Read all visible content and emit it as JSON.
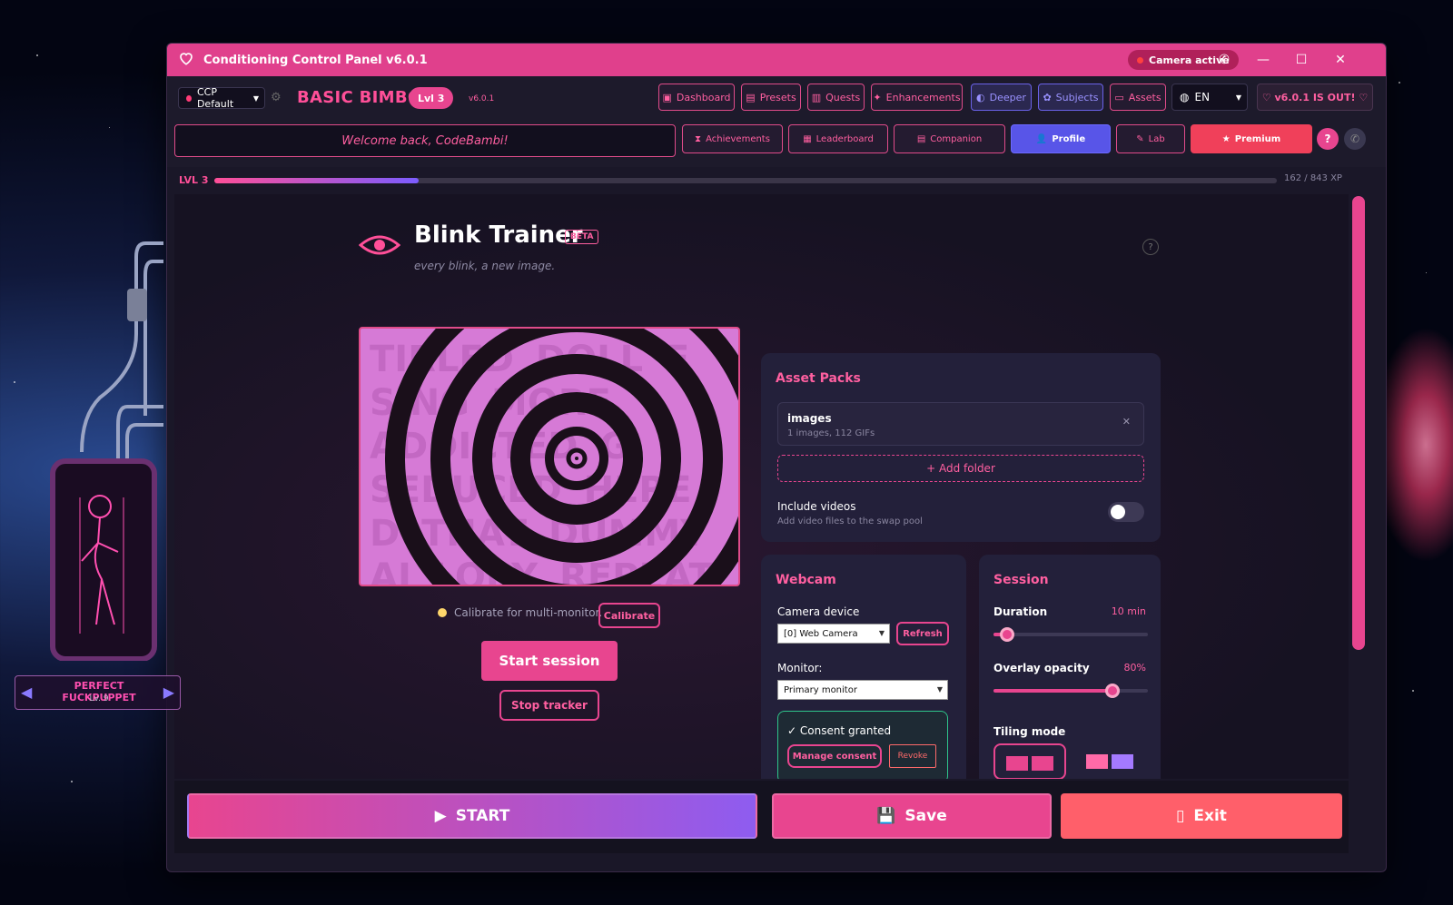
{
  "window": {
    "title": "Conditioning Control Panel v6.0.1",
    "camera_status": "Camera active"
  },
  "header": {
    "preset": "CCP Default",
    "brand": "BASIC BIMBO",
    "level_badge": "Lvl 3",
    "version": "v6.0.1",
    "nav": [
      {
        "label": "Dashboard",
        "icon": "dashboard-icon"
      },
      {
        "label": "Presets",
        "icon": "presets-icon"
      },
      {
        "label": "Quests",
        "icon": "quests-icon"
      },
      {
        "label": "Enhancements",
        "icon": "enhancements-icon"
      },
      {
        "label": "Deeper",
        "icon": "deeper-icon"
      },
      {
        "label": "Subjects",
        "icon": "subjects-icon"
      },
      {
        "label": "Assets",
        "icon": "folder-icon"
      }
    ],
    "language": "EN",
    "update_notice": "v6.0.1 IS OUT!"
  },
  "subnav": {
    "welcome": "Welcome back, CodeBambi!",
    "items": [
      {
        "label": "Achievements"
      },
      {
        "label": "Leaderboard"
      },
      {
        "label": "Companion"
      },
      {
        "label": "Profile"
      },
      {
        "label": "Lab"
      },
      {
        "label": "Premium"
      }
    ],
    "help": "?"
  },
  "xp": {
    "level_label": "LVL 3",
    "current": 162,
    "max": 843,
    "text": "162 / 843 XP",
    "fraction": 0.192
  },
  "blink_trainer": {
    "title": "Blink Trainer",
    "badge": "BETA",
    "tagline": "every blink, a new image.",
    "help": "?",
    "preview_bg_text": "TIRLED   DOLL E SING  MORE ADDICTED  G SEDUCED HERE D  THAT  DUMMY  AI  LOBY  REPEAT  MA ACTUALLY STOCKH  LOVE  MORE ADDIC",
    "calibrate_hint": "Calibrate for multi-monitor.",
    "calibrate_button": "Calibrate",
    "start_button": "Start session",
    "stop_button": "Stop tracker"
  },
  "asset_packs": {
    "title": "Asset Packs",
    "pack_name": "images",
    "pack_detail": "1 images, 112 GIFs",
    "add_folder": "+ Add folder",
    "include_videos_label": "Include videos",
    "include_videos_desc": "Add video files to the swap pool",
    "include_videos_on": false
  },
  "webcam": {
    "title": "Webcam",
    "camera_label": "Camera device",
    "camera_value": "[0] Web Camera",
    "refresh": "Refresh",
    "monitor_label": "Monitor:",
    "monitor_value": "Primary monitor",
    "consent_status": "✓ Consent granted",
    "manage_consent": "Manage consent",
    "revoke": "Revoke"
  },
  "session": {
    "title": "Session",
    "duration_label": "Duration",
    "duration_value": "10 min",
    "duration_fraction": 0.09,
    "opacity_label": "Overlay opacity",
    "opacity_value": "80%",
    "opacity_fraction": 0.77,
    "tiling_label": "Tiling mode"
  },
  "character": {
    "name": "PERFECT FUCKPUPPET",
    "level": "Lv. 9"
  },
  "footer": {
    "start": "START",
    "save": "Save",
    "exit": "Exit"
  },
  "colors": {
    "accent": "#e8458f",
    "titlebar": "#e0408c",
    "blue": "#5855e8",
    "exit": "#ff5f6a"
  }
}
